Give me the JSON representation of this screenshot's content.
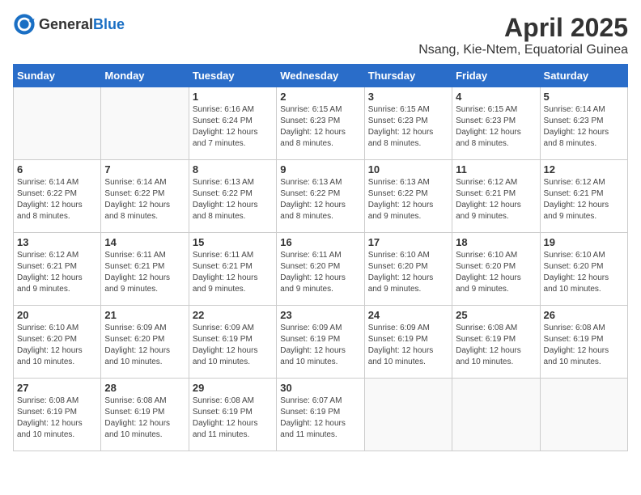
{
  "header": {
    "logo_general": "General",
    "logo_blue": "Blue",
    "month_title": "April 2025",
    "location": "Nsang, Kie-Ntem, Equatorial Guinea"
  },
  "days_of_week": [
    "Sunday",
    "Monday",
    "Tuesday",
    "Wednesday",
    "Thursday",
    "Friday",
    "Saturday"
  ],
  "weeks": [
    [
      {
        "day": "",
        "details": ""
      },
      {
        "day": "",
        "details": ""
      },
      {
        "day": "1",
        "details": "Sunrise: 6:16 AM\nSunset: 6:24 PM\nDaylight: 12 hours and 7 minutes."
      },
      {
        "day": "2",
        "details": "Sunrise: 6:15 AM\nSunset: 6:23 PM\nDaylight: 12 hours and 8 minutes."
      },
      {
        "day": "3",
        "details": "Sunrise: 6:15 AM\nSunset: 6:23 PM\nDaylight: 12 hours and 8 minutes."
      },
      {
        "day": "4",
        "details": "Sunrise: 6:15 AM\nSunset: 6:23 PM\nDaylight: 12 hours and 8 minutes."
      },
      {
        "day": "5",
        "details": "Sunrise: 6:14 AM\nSunset: 6:23 PM\nDaylight: 12 hours and 8 minutes."
      }
    ],
    [
      {
        "day": "6",
        "details": "Sunrise: 6:14 AM\nSunset: 6:22 PM\nDaylight: 12 hours and 8 minutes."
      },
      {
        "day": "7",
        "details": "Sunrise: 6:14 AM\nSunset: 6:22 PM\nDaylight: 12 hours and 8 minutes."
      },
      {
        "day": "8",
        "details": "Sunrise: 6:13 AM\nSunset: 6:22 PM\nDaylight: 12 hours and 8 minutes."
      },
      {
        "day": "9",
        "details": "Sunrise: 6:13 AM\nSunset: 6:22 PM\nDaylight: 12 hours and 8 minutes."
      },
      {
        "day": "10",
        "details": "Sunrise: 6:13 AM\nSunset: 6:22 PM\nDaylight: 12 hours and 9 minutes."
      },
      {
        "day": "11",
        "details": "Sunrise: 6:12 AM\nSunset: 6:21 PM\nDaylight: 12 hours and 9 minutes."
      },
      {
        "day": "12",
        "details": "Sunrise: 6:12 AM\nSunset: 6:21 PM\nDaylight: 12 hours and 9 minutes."
      }
    ],
    [
      {
        "day": "13",
        "details": "Sunrise: 6:12 AM\nSunset: 6:21 PM\nDaylight: 12 hours and 9 minutes."
      },
      {
        "day": "14",
        "details": "Sunrise: 6:11 AM\nSunset: 6:21 PM\nDaylight: 12 hours and 9 minutes."
      },
      {
        "day": "15",
        "details": "Sunrise: 6:11 AM\nSunset: 6:21 PM\nDaylight: 12 hours and 9 minutes."
      },
      {
        "day": "16",
        "details": "Sunrise: 6:11 AM\nSunset: 6:20 PM\nDaylight: 12 hours and 9 minutes."
      },
      {
        "day": "17",
        "details": "Sunrise: 6:10 AM\nSunset: 6:20 PM\nDaylight: 12 hours and 9 minutes."
      },
      {
        "day": "18",
        "details": "Sunrise: 6:10 AM\nSunset: 6:20 PM\nDaylight: 12 hours and 9 minutes."
      },
      {
        "day": "19",
        "details": "Sunrise: 6:10 AM\nSunset: 6:20 PM\nDaylight: 12 hours and 10 minutes."
      }
    ],
    [
      {
        "day": "20",
        "details": "Sunrise: 6:10 AM\nSunset: 6:20 PM\nDaylight: 12 hours and 10 minutes."
      },
      {
        "day": "21",
        "details": "Sunrise: 6:09 AM\nSunset: 6:20 PM\nDaylight: 12 hours and 10 minutes."
      },
      {
        "day": "22",
        "details": "Sunrise: 6:09 AM\nSunset: 6:19 PM\nDaylight: 12 hours and 10 minutes."
      },
      {
        "day": "23",
        "details": "Sunrise: 6:09 AM\nSunset: 6:19 PM\nDaylight: 12 hours and 10 minutes."
      },
      {
        "day": "24",
        "details": "Sunrise: 6:09 AM\nSunset: 6:19 PM\nDaylight: 12 hours and 10 minutes."
      },
      {
        "day": "25",
        "details": "Sunrise: 6:08 AM\nSunset: 6:19 PM\nDaylight: 12 hours and 10 minutes."
      },
      {
        "day": "26",
        "details": "Sunrise: 6:08 AM\nSunset: 6:19 PM\nDaylight: 12 hours and 10 minutes."
      }
    ],
    [
      {
        "day": "27",
        "details": "Sunrise: 6:08 AM\nSunset: 6:19 PM\nDaylight: 12 hours and 10 minutes."
      },
      {
        "day": "28",
        "details": "Sunrise: 6:08 AM\nSunset: 6:19 PM\nDaylight: 12 hours and 10 minutes."
      },
      {
        "day": "29",
        "details": "Sunrise: 6:08 AM\nSunset: 6:19 PM\nDaylight: 12 hours and 11 minutes."
      },
      {
        "day": "30",
        "details": "Sunrise: 6:07 AM\nSunset: 6:19 PM\nDaylight: 12 hours and 11 minutes."
      },
      {
        "day": "",
        "details": ""
      },
      {
        "day": "",
        "details": ""
      },
      {
        "day": "",
        "details": ""
      }
    ]
  ]
}
